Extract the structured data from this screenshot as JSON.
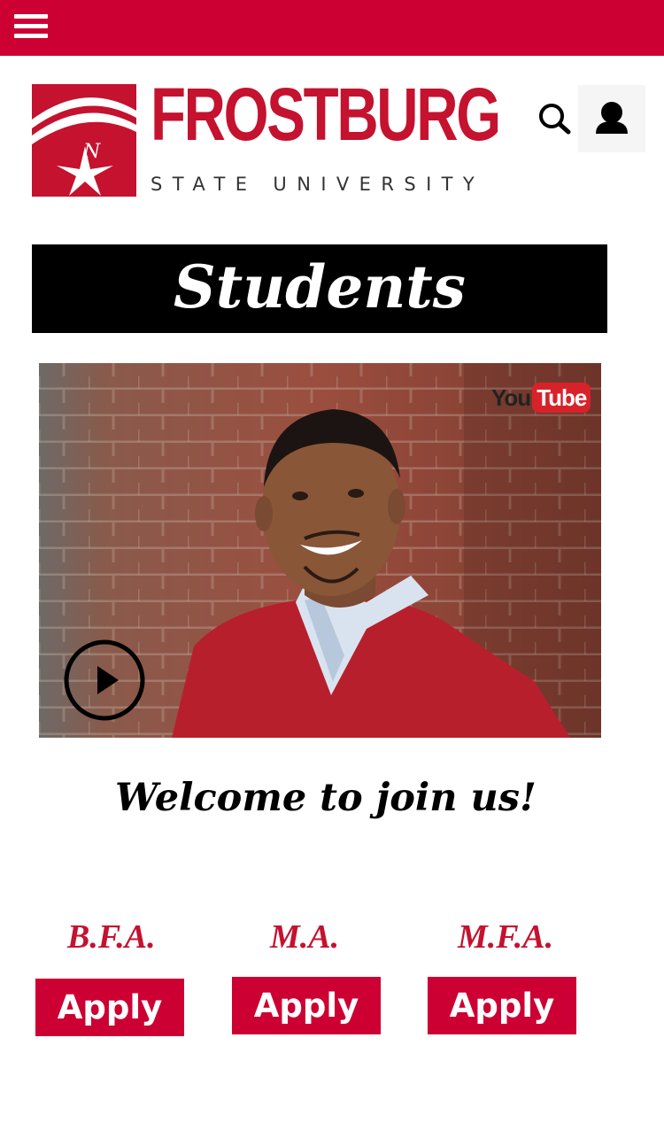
{
  "header": {
    "menu_icon": "hamburger-icon",
    "search_icon": "search-icon",
    "account_icon": "user-icon",
    "brand_color": "#cc0033"
  },
  "logo": {
    "wordmark": "FROSTBURG",
    "subtitle": "STATE UNIVERSITY",
    "compass_letter": "N"
  },
  "page": {
    "title": "Students"
  },
  "video": {
    "platform_you": "You",
    "platform_tube": "Tube",
    "play_icon": "play-icon"
  },
  "welcome": {
    "text": "Welcome to join us!"
  },
  "programs": [
    {
      "degree": "B.F.A.",
      "button": "Apply"
    },
    {
      "degree": "M.A.",
      "button": "Apply"
    },
    {
      "degree": "M.F.A.",
      "button": "Apply"
    }
  ]
}
